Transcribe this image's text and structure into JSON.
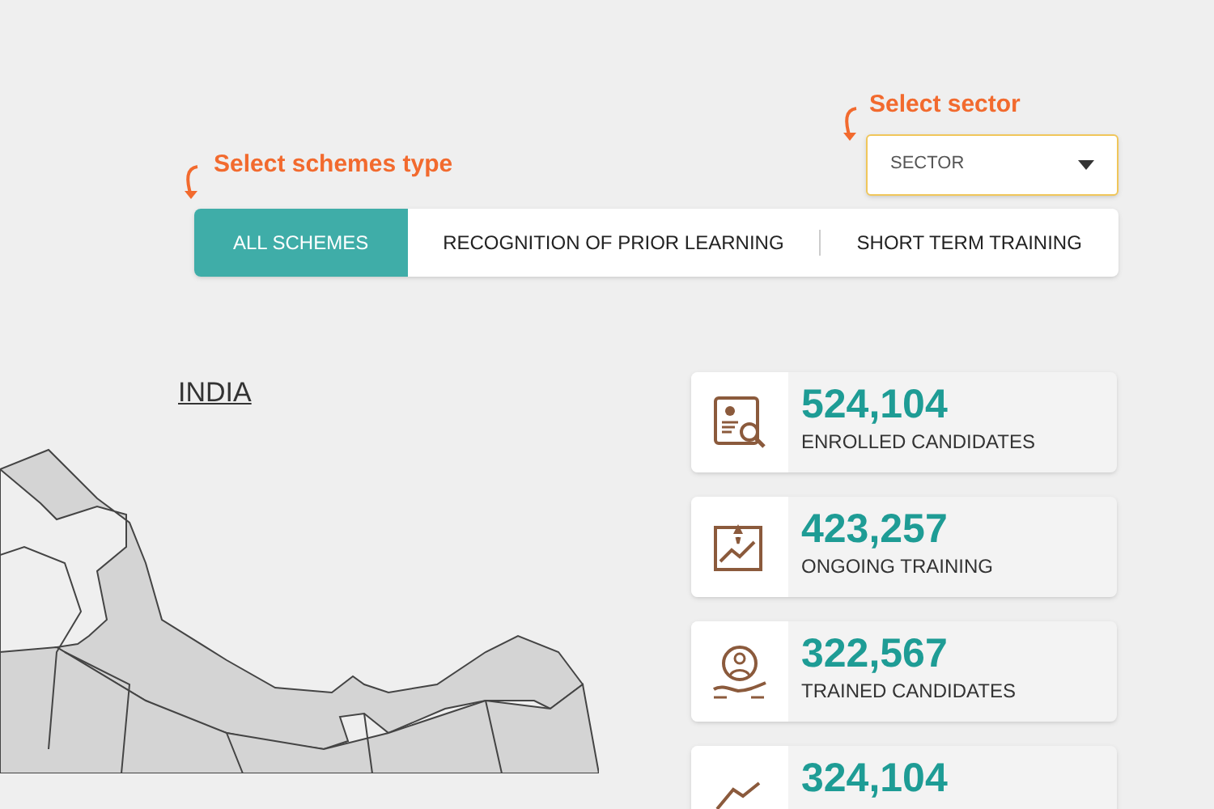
{
  "sector_hint": {
    "label": "Select sector"
  },
  "sector_dropdown": {
    "placeholder": "SECTOR"
  },
  "schemes_hint": {
    "label": "Select schemes type"
  },
  "tabs": [
    {
      "label": "ALL SCHEMES",
      "selected": true
    },
    {
      "label": "RECOGNITION OF PRIOR LEARNING",
      "selected": false
    },
    {
      "label": "SHORT TERM TRAINING",
      "selected": false
    }
  ],
  "map": {
    "title": "INDIA"
  },
  "stats": [
    {
      "kind": "enrolled",
      "value": "524,104",
      "label": "ENROLLED CANDIDATES"
    },
    {
      "kind": "ongoing",
      "value": "423,257",
      "label": "ONGOING TRAINING"
    },
    {
      "kind": "trained",
      "value": "322,567",
      "label": "TRAINED CANDIDATES"
    },
    {
      "kind": "certified",
      "value": "324,104"
    }
  ]
}
